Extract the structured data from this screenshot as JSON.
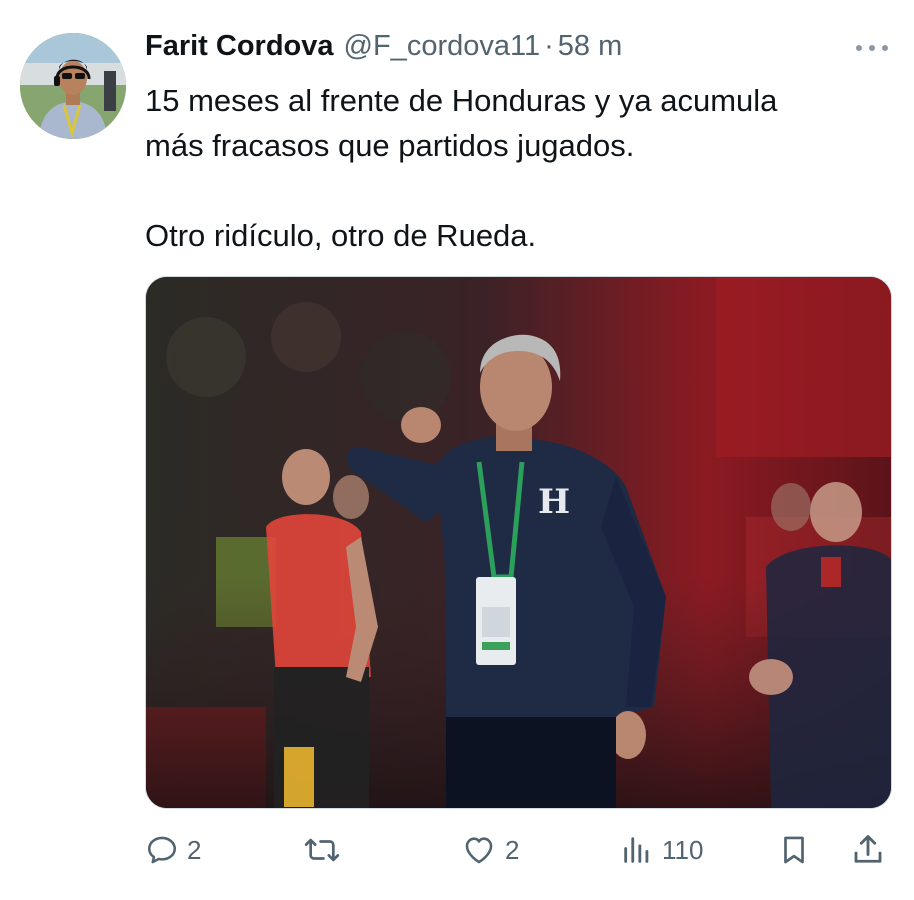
{
  "tweet": {
    "author_name": "Farit Cordova",
    "handle": "@F_cordova11",
    "separator": "·",
    "time": "58 m",
    "text_line1": "15 meses al frente de Honduras y ya acumula",
    "text_line2": "más fracasos que partidos jugados.",
    "text_line3": "Otro ridículo, otro de Rueda.",
    "media_crest_letter": "H"
  },
  "actions": {
    "replies": "2",
    "retweets": "",
    "likes": "2",
    "views": "110"
  },
  "icons": {
    "more": "more-horizontal-icon",
    "reply": "reply-icon",
    "retweet": "retweet-icon",
    "like": "heart-icon",
    "views": "views-icon",
    "bookmark": "bookmark-icon",
    "share": "share-icon"
  },
  "colors": {
    "text": "#0f1419",
    "secondary": "#536471",
    "border": "#cfd9de",
    "background": "#ffffff"
  }
}
